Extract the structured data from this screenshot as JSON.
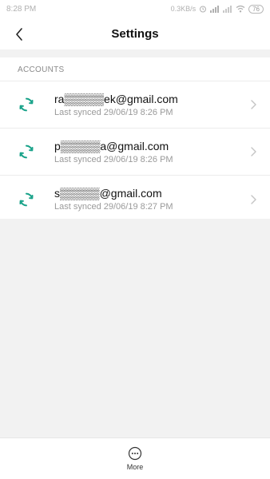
{
  "status_bar": {
    "time": "8:28 PM",
    "network_speed": "0.3KB/s",
    "battery_level": "76"
  },
  "app_bar": {
    "title": "Settings",
    "back_icon": "back-chevron-icon"
  },
  "accounts_section": {
    "header": "ACCOUNTS",
    "items": [
      {
        "email": "ra▒▒▒▒▒ek@gmail.com",
        "sync_status": "Last synced 29/06/19 8:26 PM",
        "icon": "sync-icon"
      },
      {
        "email": "p▒▒▒▒▒a@gmail.com",
        "sync_status": "Last synced 29/06/19 8:26 PM",
        "icon": "sync-icon"
      },
      {
        "email": "s▒▒▒▒▒@gmail.com",
        "sync_status": "Last synced 29/06/19 8:27 PM",
        "icon": "sync-icon"
      }
    ]
  },
  "bottom_bar": {
    "more_label": "More",
    "more_icon": "more-dots-icon"
  },
  "colors": {
    "sync_accent": "#1aa38a",
    "background": "#f2f2f2",
    "surface": "#ffffff"
  }
}
